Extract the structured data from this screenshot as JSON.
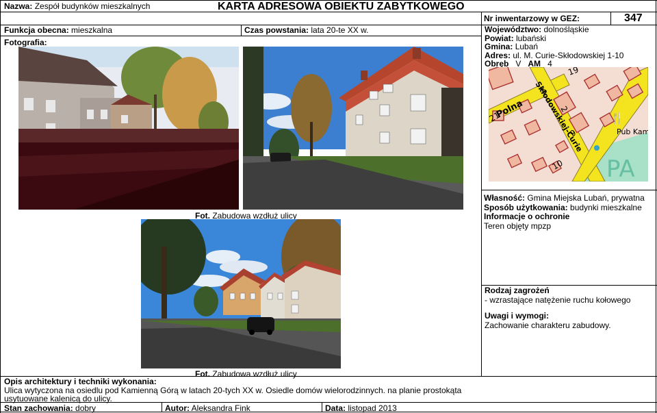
{
  "header": {
    "nazwa_label": "Nazwa:",
    "nazwa_value": "Zespół budynków mieszkalnych",
    "title": "KARTA ADRESOWA OBIEKTU ZABYTKOWEGO",
    "inv_label": "Nr inwentarzowy w GEZ:",
    "inv_value": "347"
  },
  "row2": {
    "funkcja_label": "Funkcja obecna:",
    "funkcja_value": "mieszkalna",
    "czas_label": "Czas powstania:",
    "czas_value": "lata 20-te XX w."
  },
  "location": {
    "woj_label": "Województwo:",
    "woj_value": "dolnośląskie",
    "powiat_label": "Powiat:",
    "powiat_value": "lubański",
    "gmina_label": "Gmina:",
    "gmina_value": "Lubań",
    "adres_label": "Adres:",
    "adres_value": "ul. M. Curie-Skłodowskiej 1-10",
    "obreb_label": "Obręb",
    "obreb_v": "V",
    "obreb_am": "AM",
    "obreb_num": "4"
  },
  "map": {
    "street1": "Polna",
    "street2": "Skłodowskiej-Curie",
    "num19": "19",
    "num5": "5",
    "num21": "21",
    "num2": "2",
    "num9": "9",
    "num10": "10",
    "poi": "Pub Kamienna",
    "pa": "PA"
  },
  "photos": {
    "label": "Fotografia:",
    "caption1_label": "Fot.",
    "caption1_text": "Zabudowa wzdłuż ulicy",
    "caption2_label": "Fot.",
    "caption2_text": "Zabudowa wzdłuż ulicy"
  },
  "info": {
    "wlasnosc_label": "Własność:",
    "wlasnosc_value": "Gmina Miejska Lubań, prywatna",
    "sposob_label": "Sposób użytkowania:",
    "sposob_value": "budynki mieszkalne",
    "ochrona_label": "Informacje o ochronie",
    "ochrona_value": "Teren objęty mpzp",
    "zagrozenia_label": "Rodzaj zagrożeń",
    "zagrozenia_value": "- wzrastające natężenie ruchu kołowego",
    "uwagi_label": "Uwagi i wymogi:",
    "uwagi_value": "Zachowanie charakteru zabudowy."
  },
  "opis": {
    "label": "Opis architektury i techniki wykonania:",
    "text": "Ulica wytyczona na osiedlu pod Kamienną Górą w latach 20-tych XX w. Osiedle domów wielorodzinnych. na planie prostokąta usytuowane kalenicą do ulicy."
  },
  "footer": {
    "stan_label": "Stan zachowania:",
    "stan_value": "dobry",
    "autor_label": "Autor:",
    "autor_value": "Aleksandra Fink",
    "data_label": "Data:",
    "data_value": "listopad 2013"
  }
}
